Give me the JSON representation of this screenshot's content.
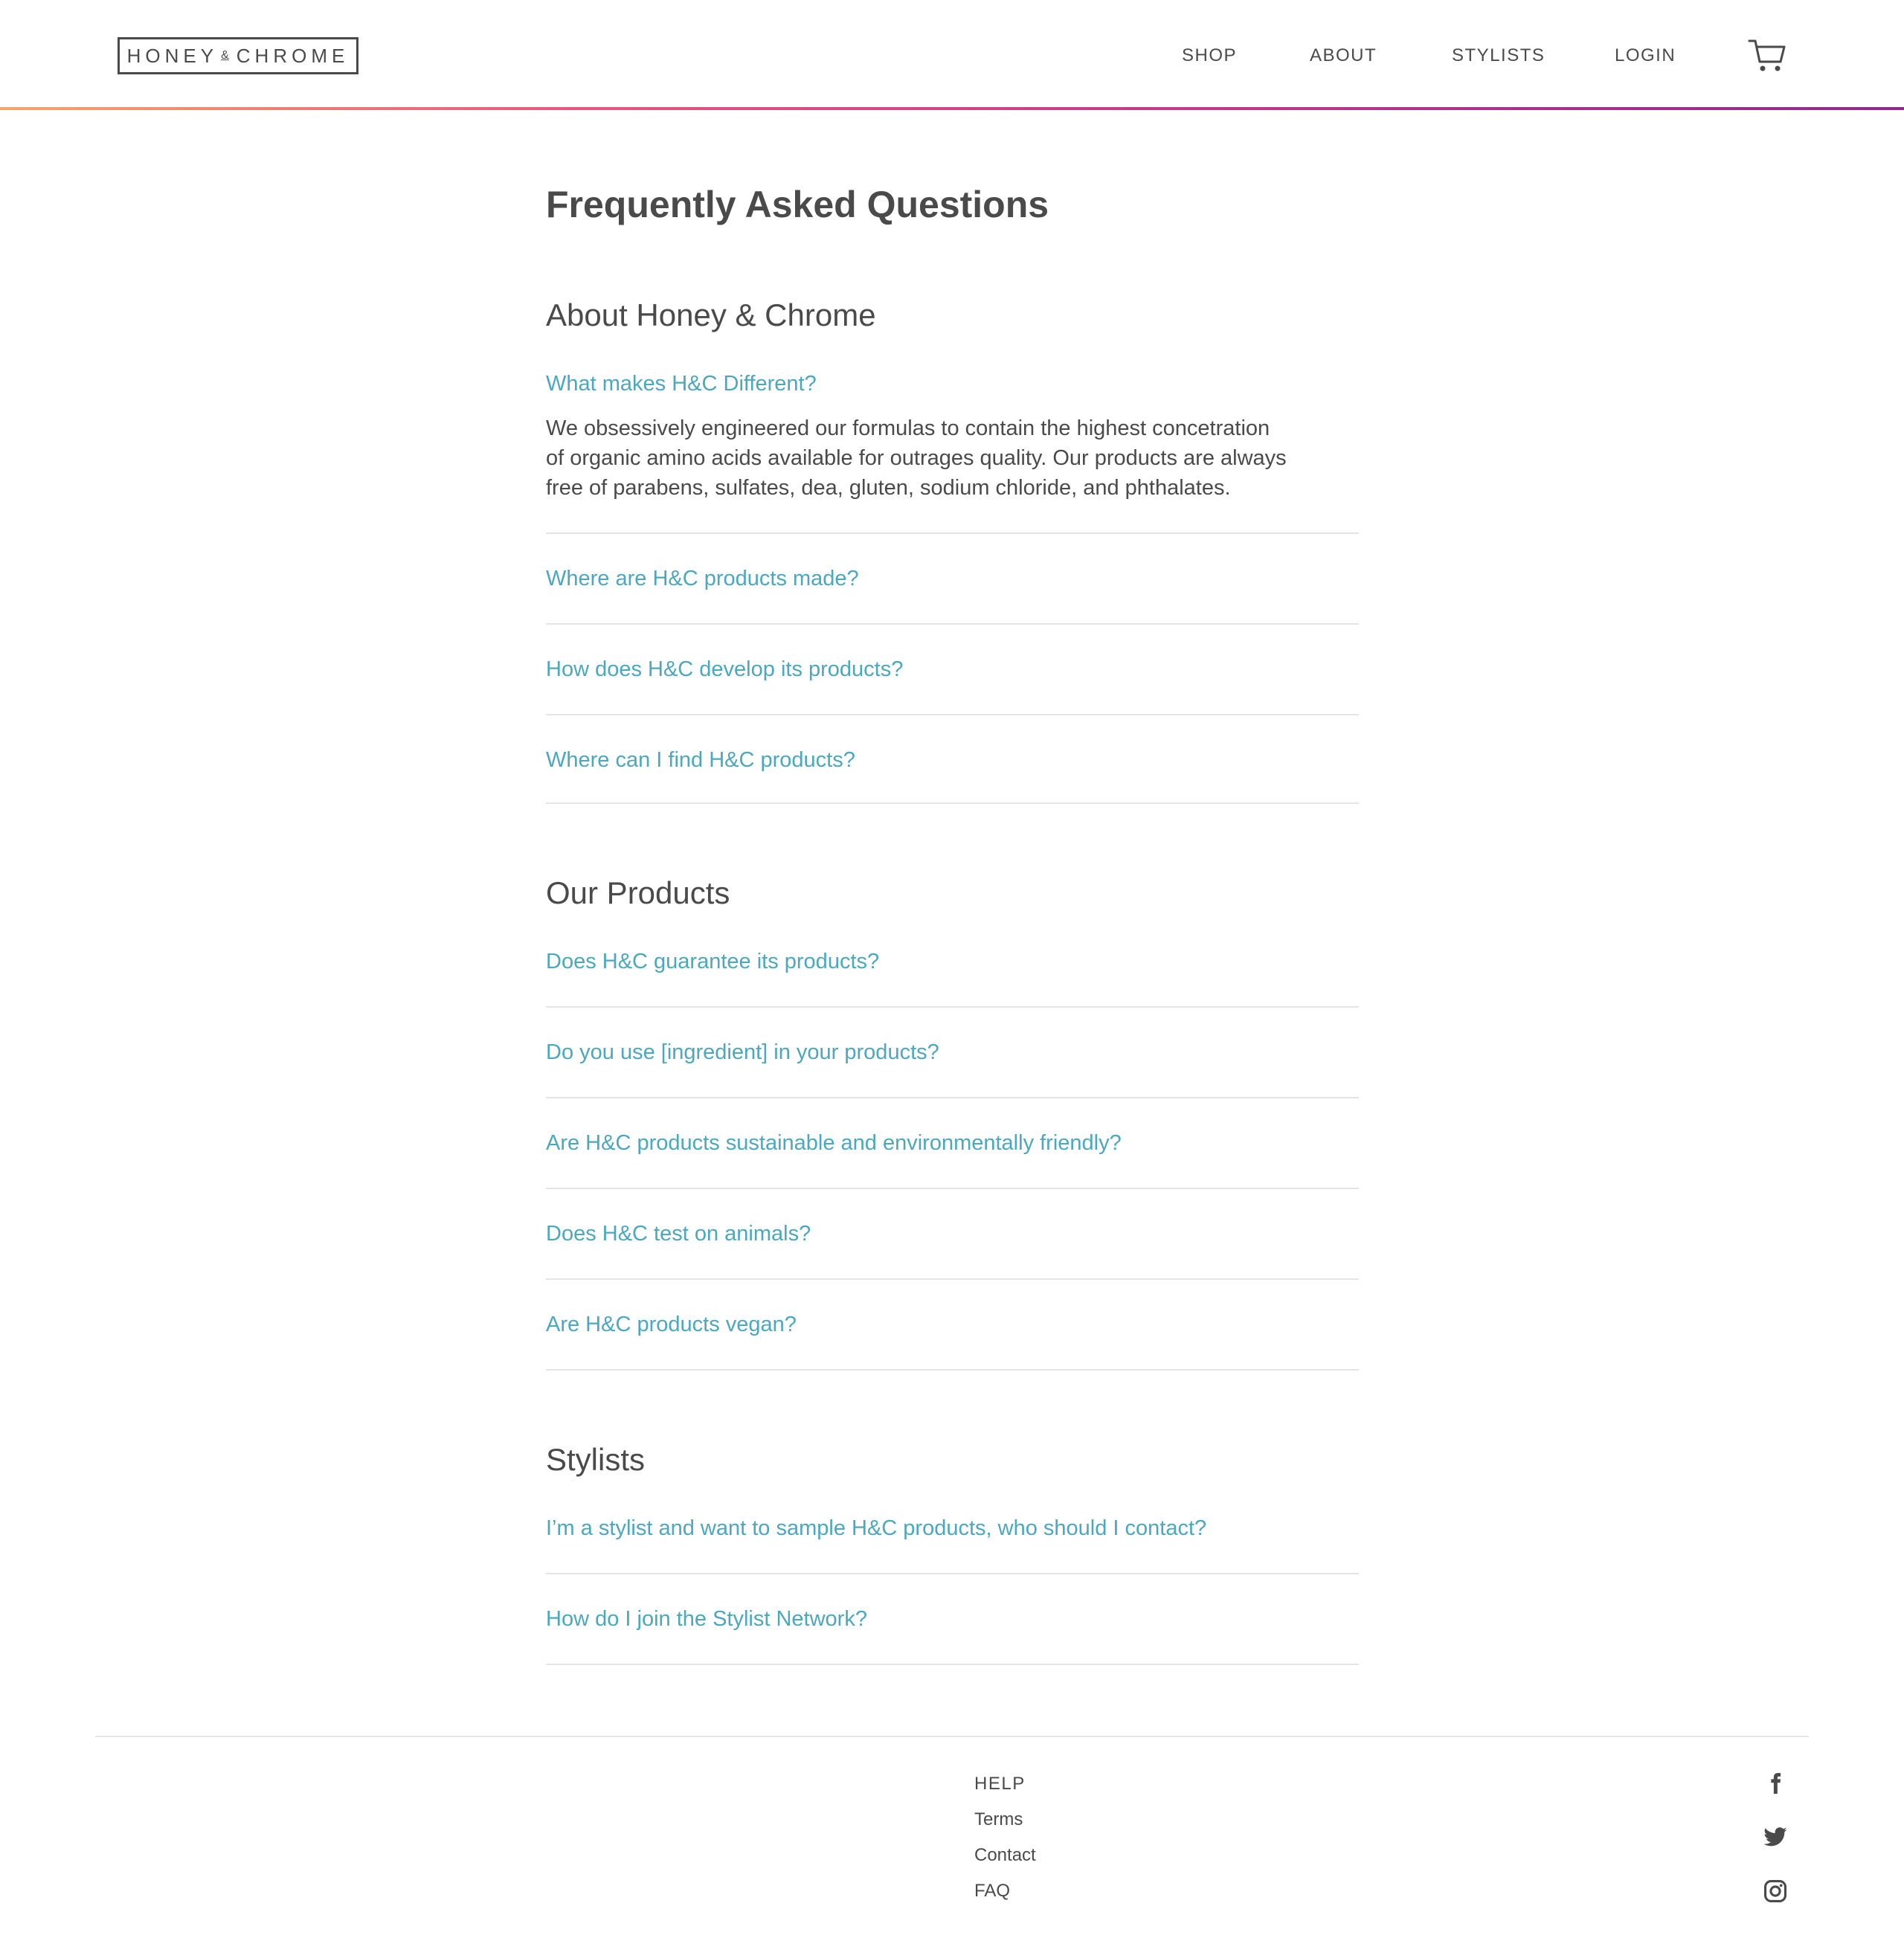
{
  "header": {
    "logo_left": "HONEY",
    "logo_amp": "&",
    "logo_right": "CHROME",
    "nav": [
      {
        "label": "SHOP"
      },
      {
        "label": "ABOUT"
      },
      {
        "label": "STYLISTS"
      },
      {
        "label": "LOGIN"
      }
    ],
    "cart_icon": "cart-icon",
    "bar_gradient": [
      "#f5a56a",
      "#e9567e",
      "#c2358a",
      "#8e2a8c"
    ]
  },
  "main": {
    "title": "Frequently Asked Questions",
    "sections": [
      {
        "title": "About Honey & Chrome",
        "questions": [
          {
            "q": "What makes H&C Different?",
            "answer_lines": [
              "We obsessively engineered our formulas to contain the highest concetration",
              "of organic amino acids available for outrages quality. Our products are always",
              "free of parabens, sulfates, dea, gluten, sodium chloride, and phthalates."
            ]
          },
          {
            "q": "Where are H&C products made?"
          },
          {
            "q": "How does H&C develop its products?"
          },
          {
            "q": "Where can I find H&C products?"
          }
        ]
      },
      {
        "title": "Our Products",
        "questions": [
          {
            "q": "Does H&C guarantee its products?"
          },
          {
            "q": "Do you use [ingredient] in your products?"
          },
          {
            "q": "Are H&C products sustainable and environmentally friendly?"
          },
          {
            "q": "Does H&C test on animals?"
          },
          {
            "q": "Are H&C products vegan?"
          }
        ]
      },
      {
        "title": "Stylists",
        "questions": [
          {
            "q": "I’m a stylist and want to sample H&C products, who should I contact?"
          },
          {
            "q": "How do I join the Stylist Network?"
          }
        ]
      }
    ]
  },
  "footer": {
    "heading": "HELP",
    "links": [
      {
        "label": "Terms"
      },
      {
        "label": "Contact"
      },
      {
        "label": "FAQ"
      }
    ],
    "social_icons": [
      "facebook-icon",
      "twitter-icon",
      "instagram-icon"
    ]
  },
  "colors": {
    "text": "#4a4a4a",
    "link": "#4aa8c0",
    "divider": "#e5e5e5"
  }
}
